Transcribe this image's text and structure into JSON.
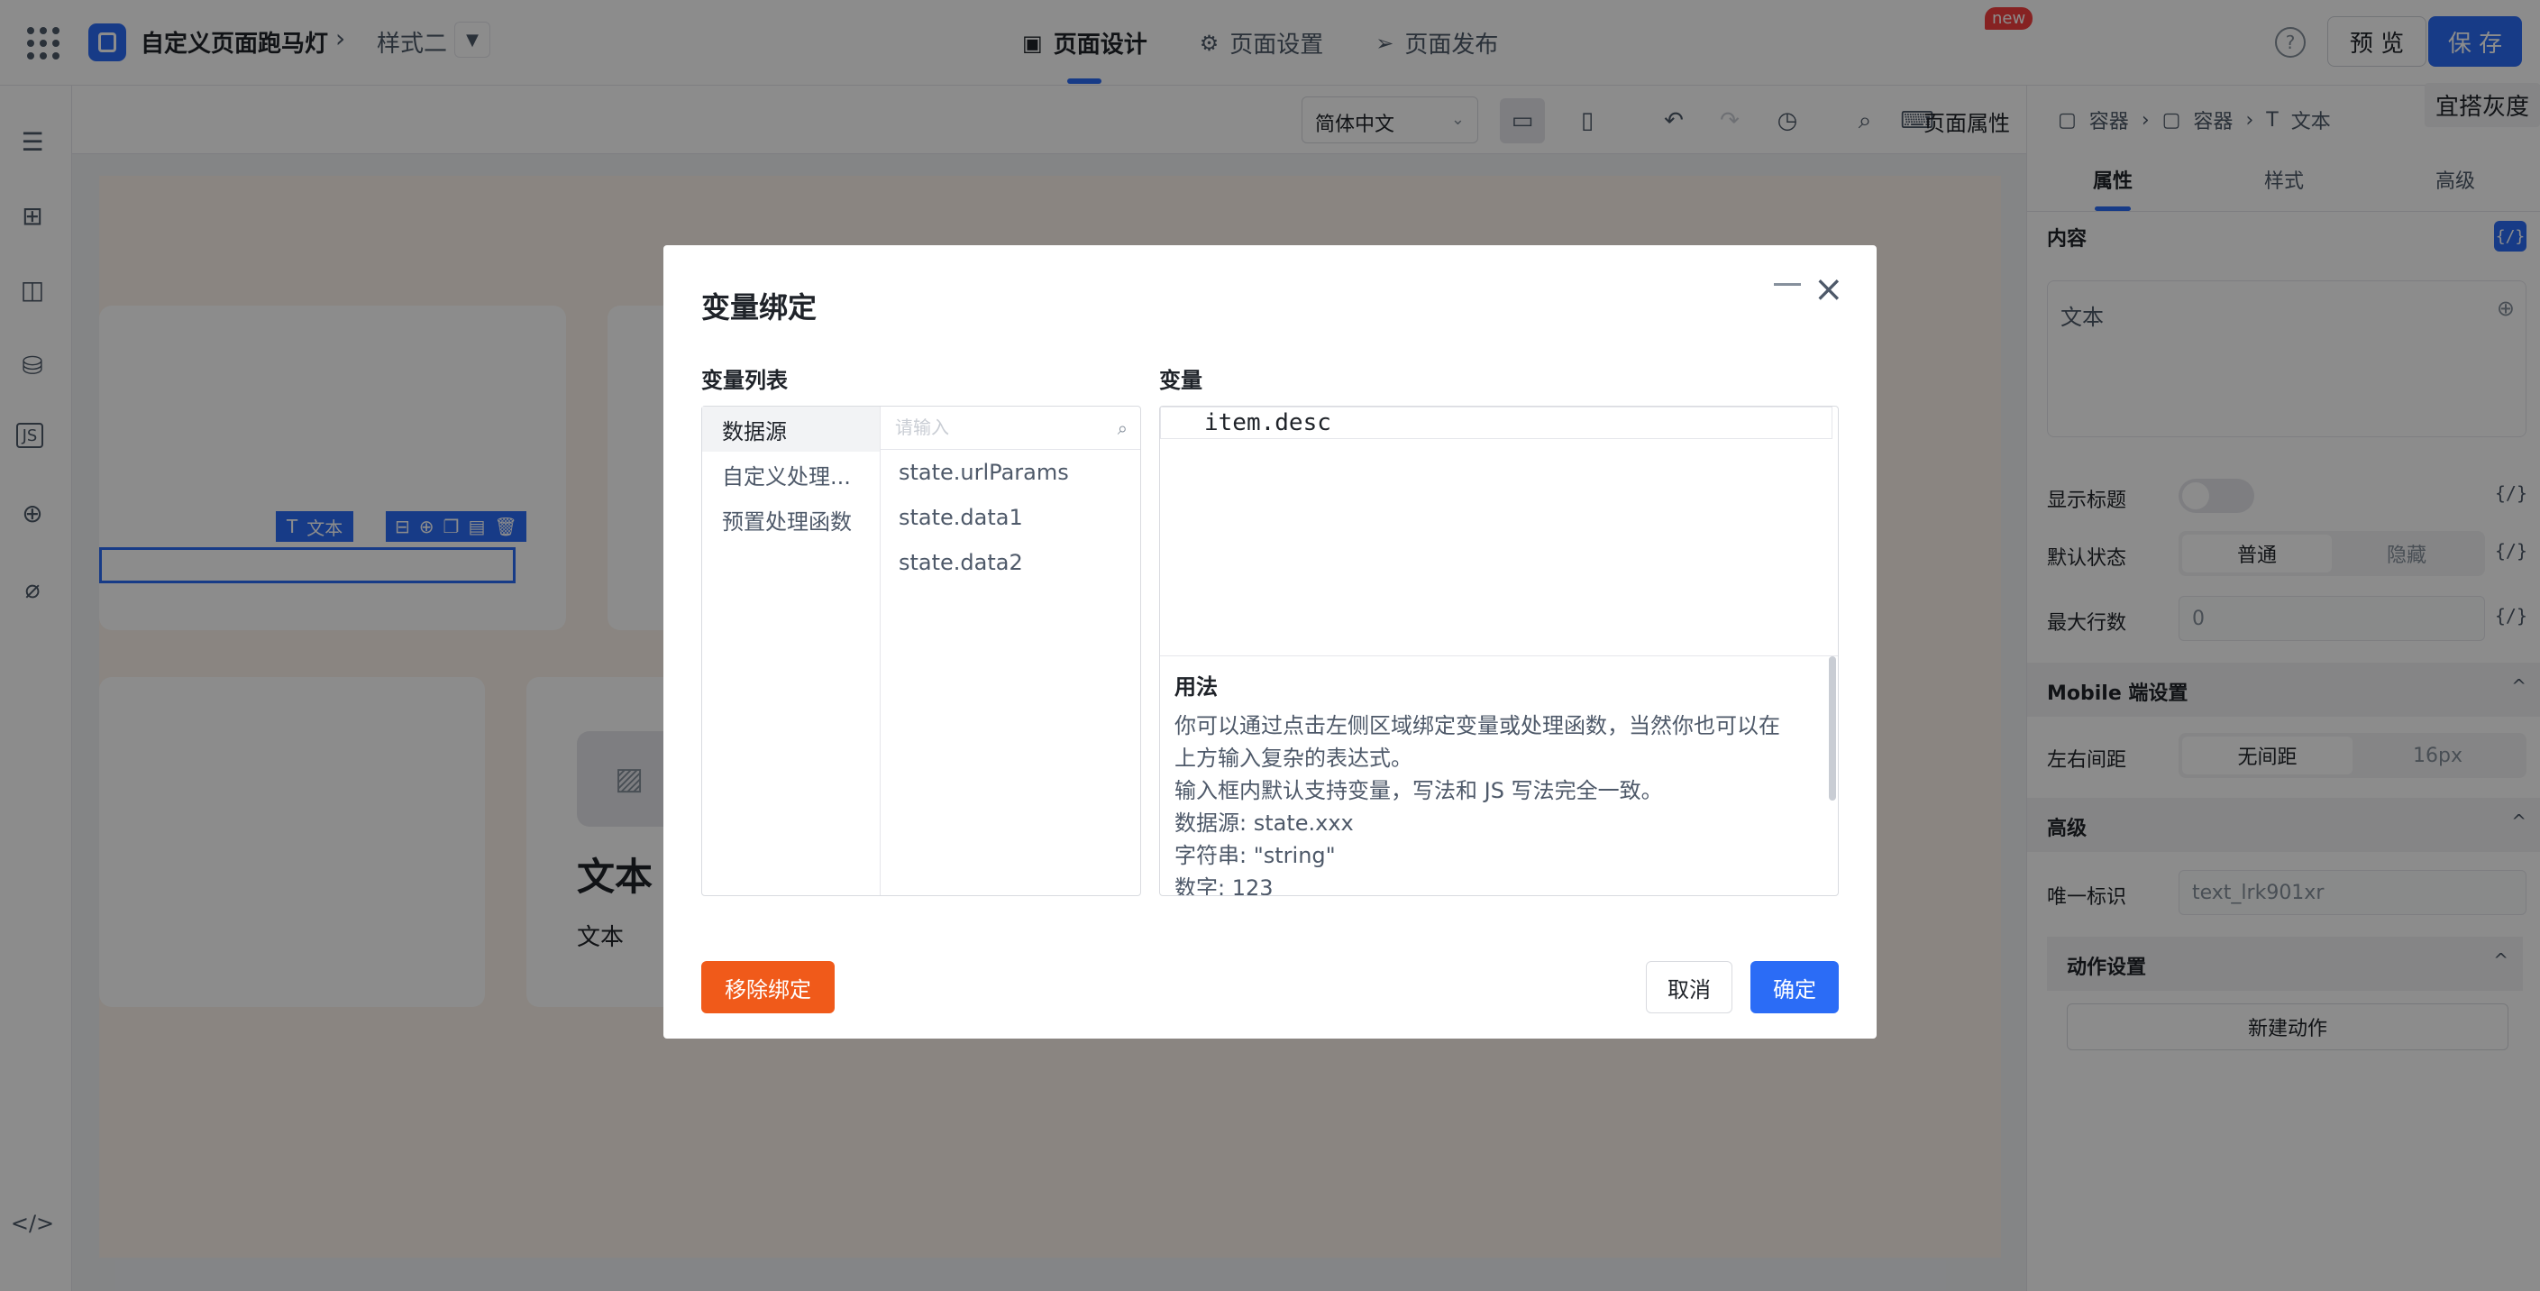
{
  "header": {
    "app_title": "自定义页面跑马灯",
    "style_name": "样式二",
    "tabs": [
      {
        "label": "页面设计",
        "icon": "page-icon"
      },
      {
        "label": "页面设置",
        "icon": "gear-icon"
      },
      {
        "label": "页面发布",
        "icon": "send-icon"
      }
    ],
    "preview_label": "预 览",
    "save_label": "保 存"
  },
  "toolbar": {
    "language": "简体中文",
    "page_props": "页面属性",
    "new_badge": "new"
  },
  "gray_hint": "宜搭灰度",
  "canvas": {
    "chip_label": "文本",
    "card_title": "文本",
    "card_desc": "文本"
  },
  "right_panel": {
    "breadcrumb": [
      "容器",
      "容器",
      "文本"
    ],
    "tabs": [
      "属性",
      "样式",
      "高级"
    ],
    "content_label": "内容",
    "content_value": "文本",
    "fx_label": "{/}",
    "show_title_label": "显示标题",
    "default_state_label": "默认状态",
    "default_state_options": [
      "普通",
      "隐藏"
    ],
    "max_lines_label": "最大行数",
    "max_lines_value": "0",
    "mobile_section": "Mobile 端设置",
    "padding_label": "左右间距",
    "padding_options": [
      "无间距",
      "16px"
    ],
    "advanced_section": "高级",
    "uid_label": "唯一标识",
    "uid_value": "text_lrk901xr",
    "actions_section": "动作设置",
    "new_action": "新建动作",
    "chevron": "^"
  },
  "modal": {
    "title": "变量绑定",
    "var_list_title": "变量列表",
    "variable_title": "变量",
    "categories": [
      "数据源",
      "自定义处理...",
      "预置处理函数"
    ],
    "search_placeholder": "请输入",
    "items": [
      "state.urlParams",
      "state.data1",
      "state.data2"
    ],
    "code": "item.desc",
    "usage_title": "用法",
    "usage_lines": [
      "你可以通过点击左侧区域绑定变量或处理函数，当然你也可以在",
      "上方输入复杂的表达式。",
      "输入框内默认支持变量，写法和 JS 写法完全一致。",
      "数据源: state.xxx",
      "字符串: \"string\"",
      "数字: 123"
    ],
    "remove_label": "移除绑定",
    "cancel_label": "取消",
    "ok_label": "确定"
  }
}
